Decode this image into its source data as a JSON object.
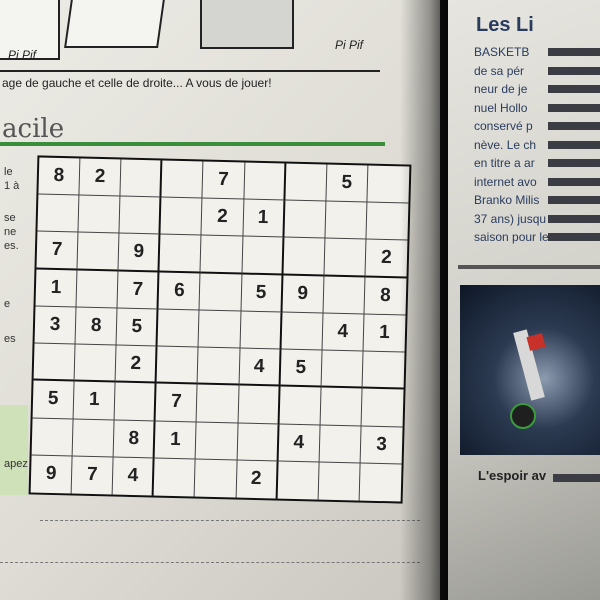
{
  "cartoon": {
    "signature": "Pi Pif"
  },
  "caption": "age de gauche et celle de droite... A vous de jouer!",
  "section": {
    "title": "acile"
  },
  "left_margin_text": [
    "le",
    "1 à",
    "se",
    "ne",
    "es.",
    "e",
    "es",
    "apez"
  ],
  "sudoku": {
    "grid": [
      [
        "8",
        "2",
        "",
        "",
        "7",
        "",
        "",
        "5",
        ""
      ],
      [
        "",
        "",
        "",
        "",
        "2",
        "1",
        "",
        "",
        ""
      ],
      [
        "7",
        "",
        "9",
        "",
        "",
        "",
        "",
        "",
        "2"
      ],
      [
        "1",
        "",
        "7",
        "6",
        "",
        "5",
        "9",
        "",
        "8"
      ],
      [
        "3",
        "8",
        "5",
        "",
        "",
        "",
        "",
        "4",
        "1"
      ],
      [
        "",
        "",
        "2",
        "",
        "",
        "4",
        "5",
        "",
        ""
      ],
      [
        "5",
        "1",
        "",
        "7",
        "",
        "",
        "",
        "",
        ""
      ],
      [
        "",
        "",
        "8",
        "1",
        "",
        "",
        "4",
        "",
        "3"
      ],
      [
        "9",
        "7",
        "4",
        "",
        "",
        "2",
        "",
        "",
        ""
      ]
    ]
  },
  "right_page": {
    "title": "Les Li",
    "lines": [
      "BASKETB",
      "de sa pér",
      "neur de je",
      "nuel Hollo",
      "conservé p",
      "nève. Le ch",
      "en titre a ar",
      "internet avo",
      "Branko Milis",
      "37 ans) jusqu",
      "saison pour le"
    ],
    "photo_caption": "L'espoir av"
  }
}
